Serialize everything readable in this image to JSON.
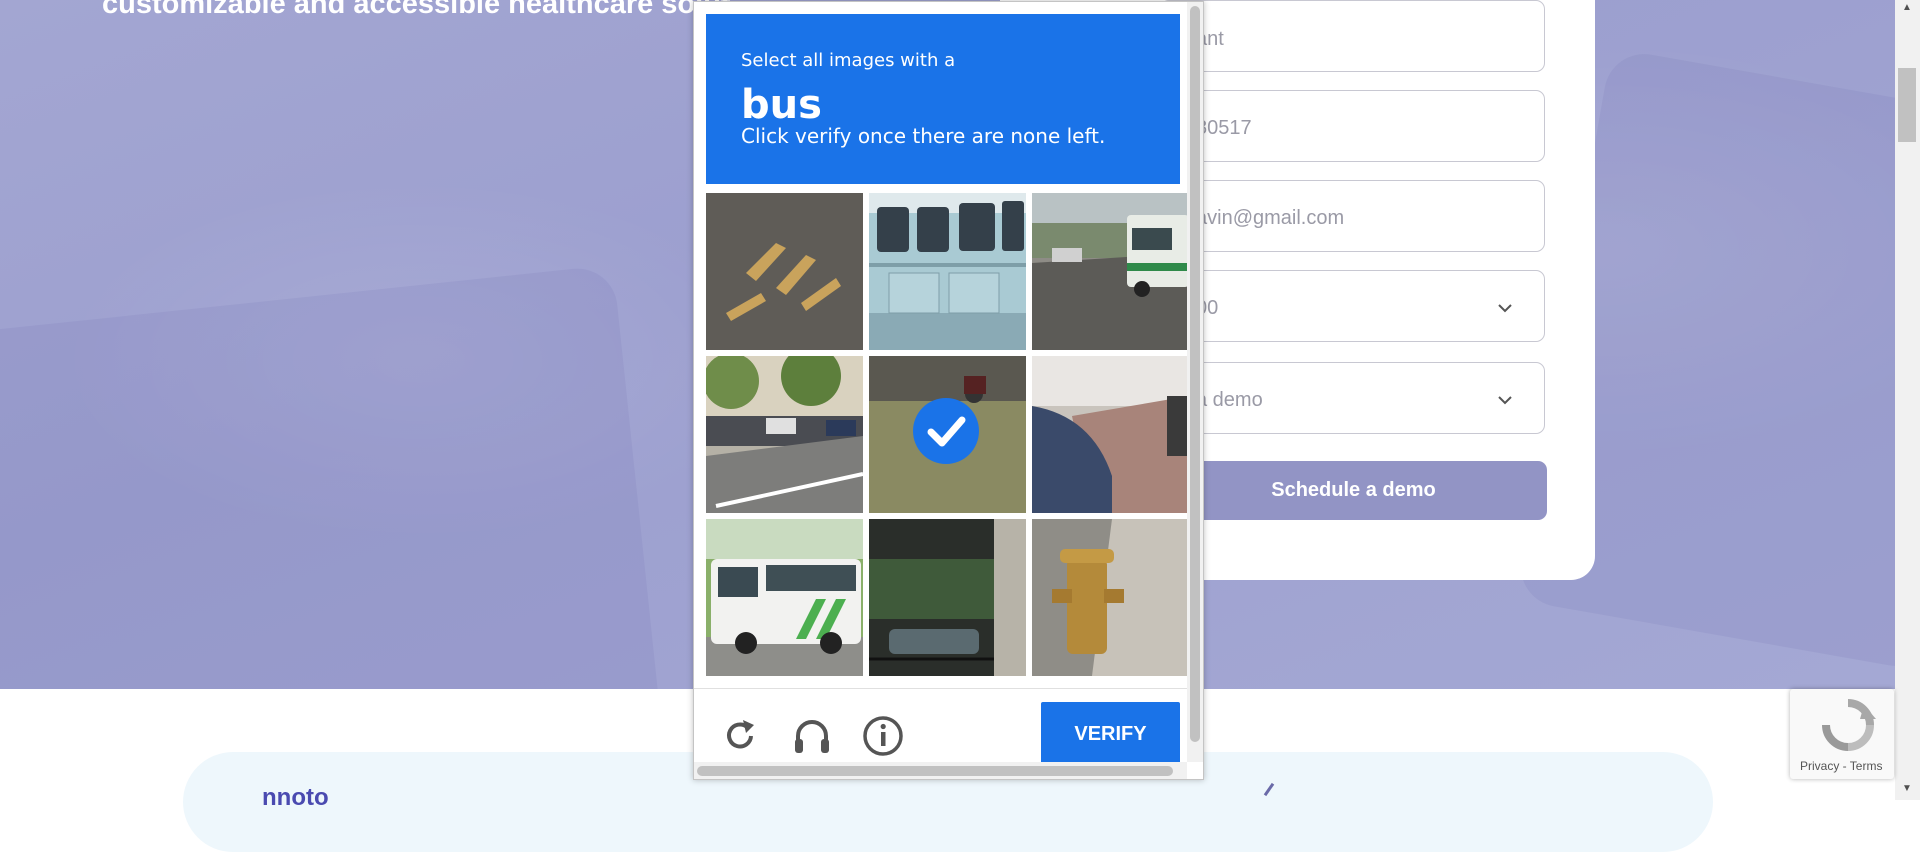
{
  "hero": {
    "tagline": "customizable and accessible healthcare solut"
  },
  "form": {
    "fields": [
      {
        "value": "ant"
      },
      {
        "value": "80517"
      },
      {
        "value": "avin@gmail.com"
      },
      {
        "value": "00"
      },
      {
        "value": "a demo"
      }
    ],
    "submit_label": "Schedule a demo"
  },
  "captcha": {
    "instruction_line1": "Select all images with a",
    "target_word": "bus",
    "instruction_line3": "Click verify once there are none left.",
    "tiles": [
      {
        "name": "road-marking",
        "selected": false
      },
      {
        "name": "bus-side-closeup",
        "selected": false
      },
      {
        "name": "bus-on-street",
        "selected": false
      },
      {
        "name": "parked-cars-street",
        "selected": false
      },
      {
        "name": "motorcycle-grass",
        "selected": true
      },
      {
        "name": "car-sidewalk",
        "selected": false
      },
      {
        "name": "white-green-bus",
        "selected": false
      },
      {
        "name": "car-under-building",
        "selected": false
      },
      {
        "name": "fire-hydrant",
        "selected": false
      }
    ],
    "verify_label": "VERIFY",
    "icons": [
      "reload-icon",
      "audio-icon",
      "info-icon"
    ]
  },
  "recaptcha_badge": {
    "text": "Privacy - Terms"
  },
  "lower_section": {
    "heading_fragment": "nnoto"
  },
  "colors": {
    "captcha_blue": "#1a73e8",
    "hero_bg": "#a1a4d2",
    "button_purple": "#9294c5"
  }
}
